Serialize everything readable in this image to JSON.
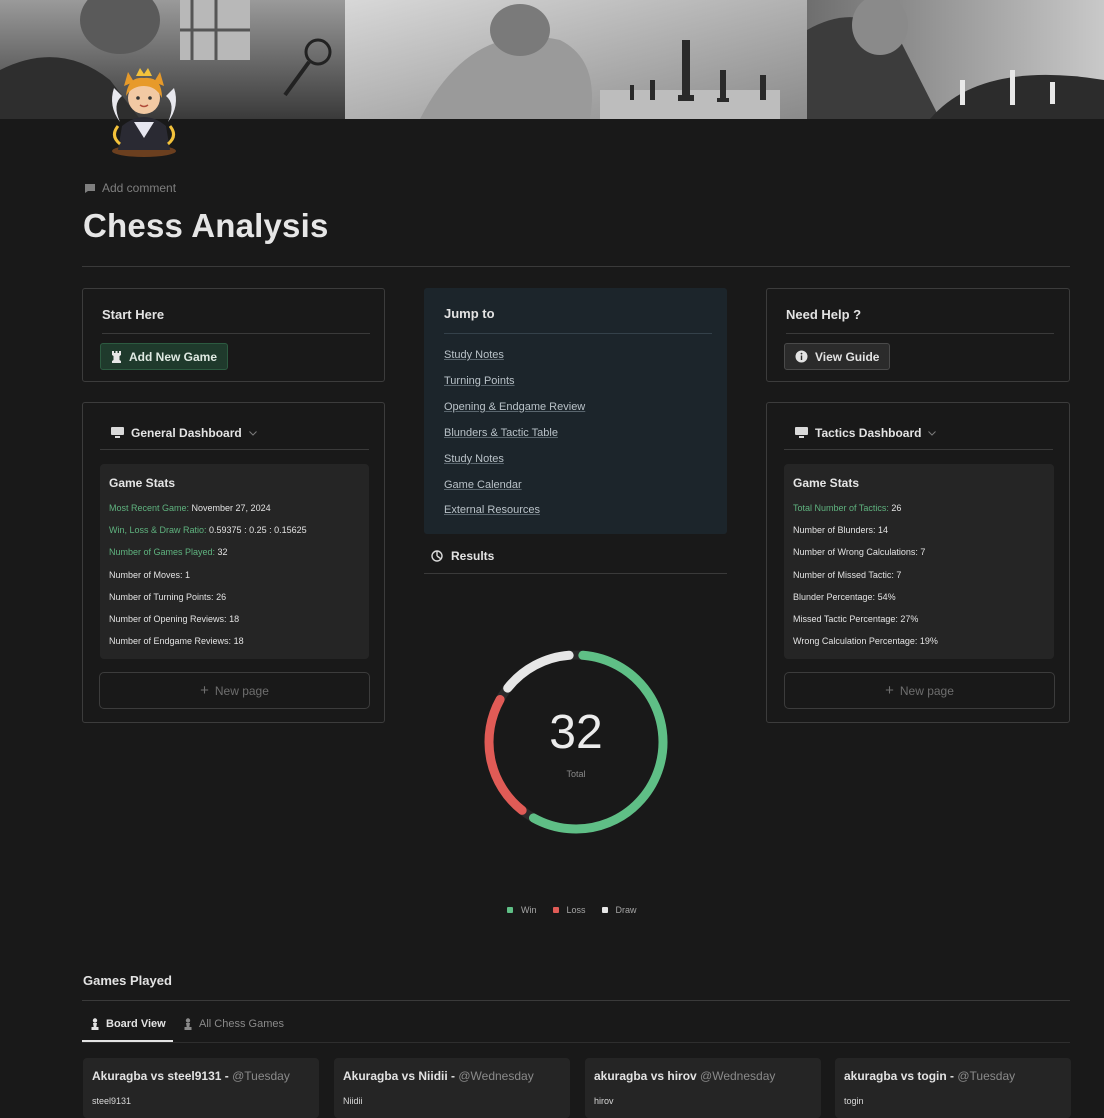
{
  "page": {
    "add_comment": "Add comment",
    "title": "Chess Analysis"
  },
  "start_here": {
    "heading": "Start Here",
    "button": "Add New Game",
    "button_icon": "rook-icon"
  },
  "general_dashboard": {
    "heading": "General Dashboard",
    "stats_title": "Game Stats",
    "stats": [
      {
        "label": "Most Recent Game:",
        "value": "November 27, 2024",
        "highlight": true
      },
      {
        "label": "Win, Loss & Draw Ratio:",
        "value": "0.59375 : 0.25 : 0.15625",
        "highlight": true
      },
      {
        "label": "Number of Games Played:",
        "value": "32",
        "highlight": true
      },
      {
        "label": "Number of Moves:",
        "value": "1",
        "highlight": false
      },
      {
        "label": "Number of Turning Points:",
        "value": "26",
        "highlight": false
      },
      {
        "label": "Number of Opening Reviews:",
        "value": "18",
        "highlight": false
      },
      {
        "label": "Number of Endgame Reviews:",
        "value": "18",
        "highlight": false
      }
    ],
    "new_page": "New page"
  },
  "jump_to": {
    "heading": "Jump to",
    "links": [
      "Study Notes",
      "Turning Points",
      "Opening & Endgame Review",
      "Blunders & Tactic Table",
      "Study Notes",
      "Game Calendar",
      "External Resources"
    ]
  },
  "results": {
    "heading": "Results",
    "total": "32",
    "total_label": "Total",
    "legend": [
      {
        "name": "Win",
        "color": "#5fbf86"
      },
      {
        "name": "Loss",
        "color": "#e05b56"
      },
      {
        "name": "Draw",
        "color": "#e6e6e6"
      }
    ]
  },
  "chart_data": {
    "type": "pie",
    "categories": [
      "Win",
      "Loss",
      "Draw"
    ],
    "values": [
      19,
      8,
      5
    ],
    "colors": [
      "#5fbf86",
      "#e05b56",
      "#e6e6e6"
    ],
    "center_value": "32",
    "center_label": "Total"
  },
  "need_help": {
    "heading": "Need Help ?",
    "button": "View Guide"
  },
  "tactics_dashboard": {
    "heading": "Tactics Dashboard",
    "stats_title": "Game Stats",
    "stats": [
      {
        "label": "Total Number of Tactics:",
        "value": "26",
        "highlight": true
      },
      {
        "label": "Number of Blunders:",
        "value": "14",
        "highlight": false
      },
      {
        "label": "Number of Wrong Calculations:",
        "value": "7",
        "highlight": false
      },
      {
        "label": "Number of Missed Tactic:",
        "value": "7",
        "highlight": false
      },
      {
        "label": "Blunder Percentage:",
        "value": "54%",
        "highlight": false
      },
      {
        "label": "Missed Tactic Percentage:",
        "value": "27%",
        "highlight": false
      },
      {
        "label": "Wrong Calculation Percentage:",
        "value": "19%",
        "highlight": false
      }
    ],
    "new_page": "New page"
  },
  "games_played": {
    "heading": "Games Played",
    "tabs": [
      {
        "label": "Board View",
        "active": true
      },
      {
        "label": "All Chess Games",
        "active": false
      }
    ],
    "cards": [
      {
        "title": "Akuragba vs steel9131 -",
        "day": "@Tuesday",
        "opponent": "steel9131"
      },
      {
        "title": "Akuragba vs Niidii -",
        "day": "@Wednesday",
        "opponent": "Niidii"
      },
      {
        "title": "akuragba vs hirov",
        "day": "@Wednesday",
        "opponent": "hirov"
      },
      {
        "title": "akuragba vs togin -",
        "day": "@Tuesday",
        "opponent": "togin"
      }
    ]
  }
}
